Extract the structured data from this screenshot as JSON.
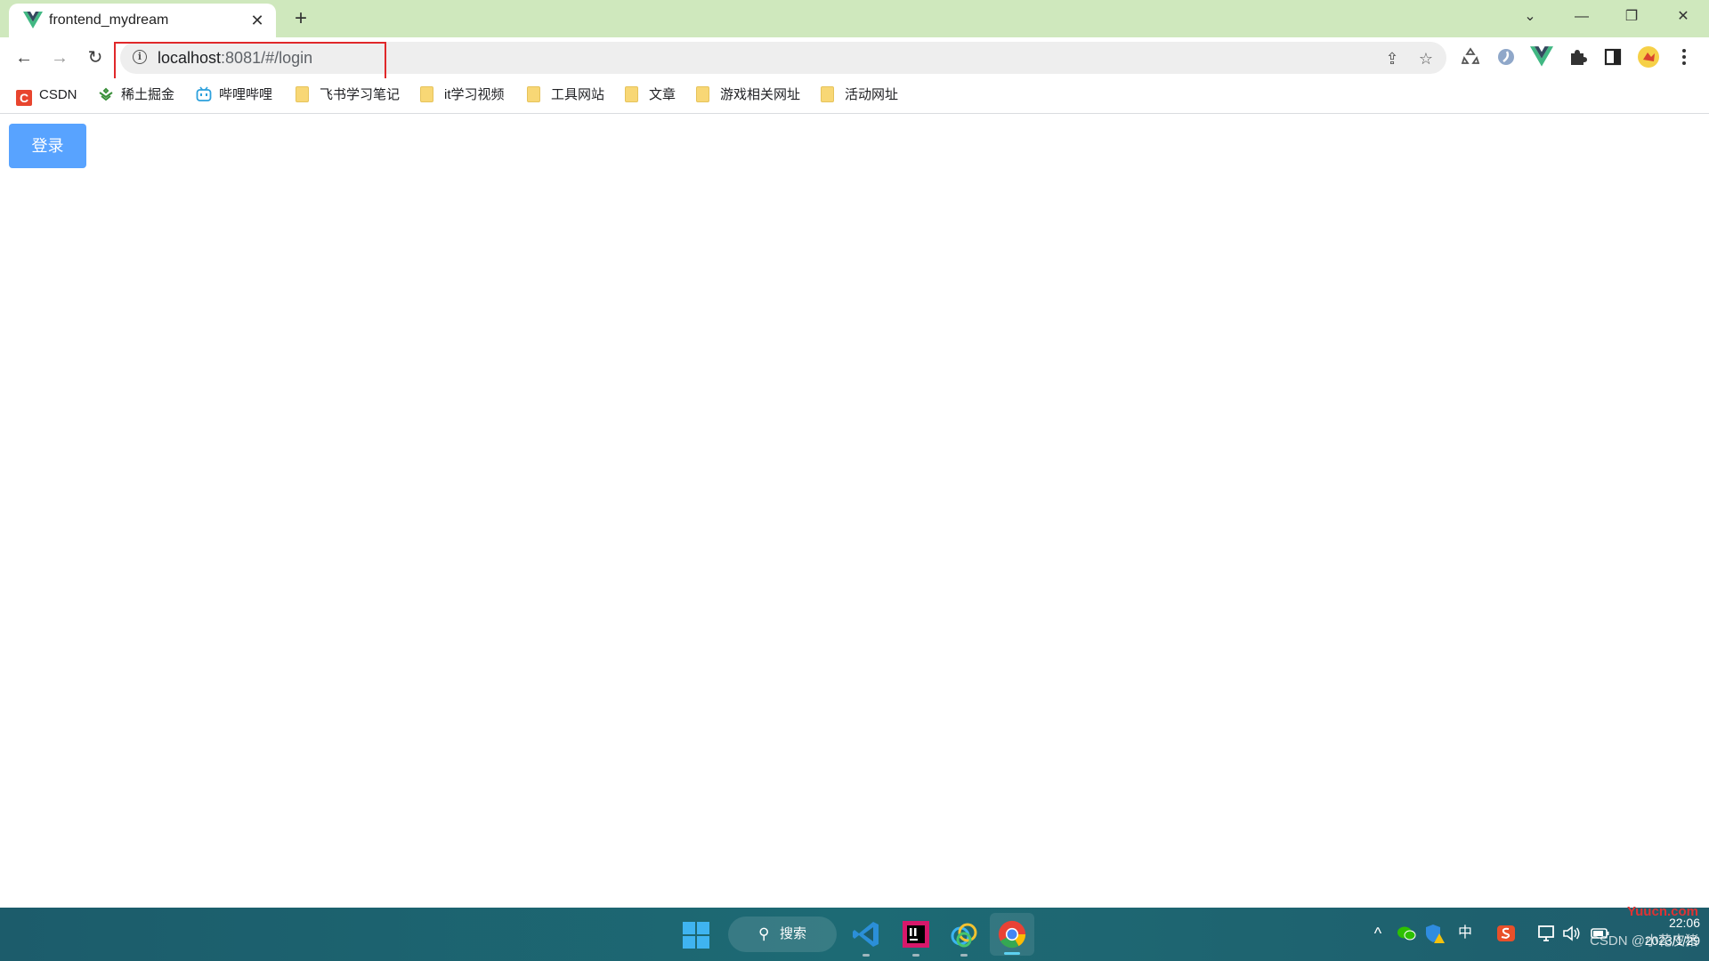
{
  "browser": {
    "tab": {
      "title": "frontend_mydream",
      "close_glyph": "✕",
      "favicon": "vue-icon"
    },
    "new_tab_glyph": "+",
    "window_controls": {
      "dropdown": "⌄",
      "minimize": "—",
      "restore": "❐",
      "close": "✕"
    },
    "toolbar": {
      "back_glyph": "←",
      "forward_glyph": "→",
      "reload_glyph": "↻",
      "url_host": "localhost",
      "url_rest": ":8081/#/login",
      "info_glyph": "i",
      "share_glyph": "⇪",
      "star_glyph": "☆"
    },
    "highlight_color": "#e0282a",
    "bookmarks": [
      {
        "label": "CSDN",
        "icon": "csdn-icon"
      },
      {
        "label": "稀土掘金",
        "icon": "juejin-icon"
      },
      {
        "label": "哔哩哔哩",
        "icon": "bilibili-icon"
      },
      {
        "label": "飞书学习笔记",
        "icon": "folder-icon"
      },
      {
        "label": "it学习视频",
        "icon": "folder-icon"
      },
      {
        "label": "工具网站",
        "icon": "folder-icon"
      },
      {
        "label": "文章",
        "icon": "folder-icon"
      },
      {
        "label": "游戏相关网址",
        "icon": "folder-icon"
      },
      {
        "label": "活动网址",
        "icon": "folder-icon"
      }
    ]
  },
  "page": {
    "login_button": "登录",
    "accent_color": "#58a3ff"
  },
  "taskbar": {
    "search_label": "搜索",
    "search_glyph": "⚲",
    "ime_label": "中",
    "tray_up_glyph": "^",
    "clock_time": "22:06",
    "clock_date": "2023/1/29",
    "watermark_brand": "Yuucn.com",
    "watermark": "CSDN @小花皮猪"
  }
}
